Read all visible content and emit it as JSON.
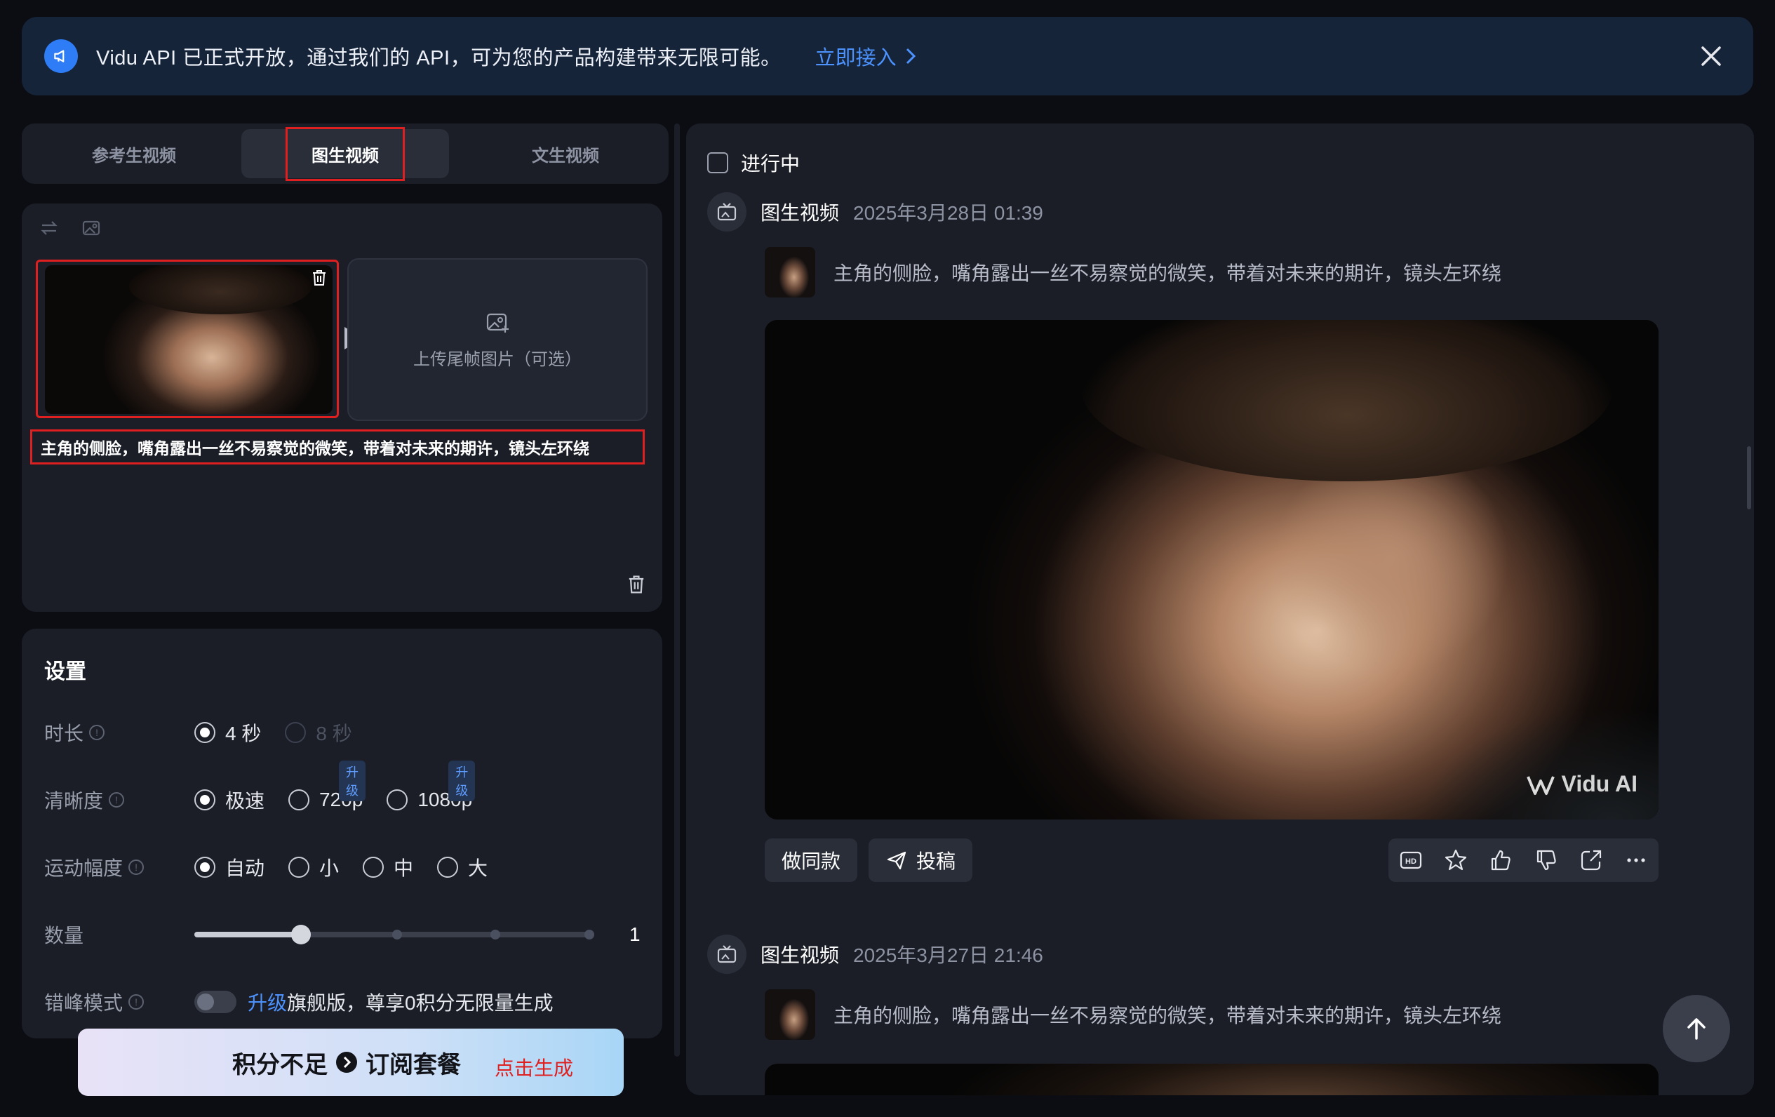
{
  "banner": {
    "text": "Vidu API 已正式开放，通过我们的 API，可为您的产品构建带来无限可能。",
    "link": "立即接入"
  },
  "tabs": [
    "参考生视频",
    "图生视频",
    "文生视频"
  ],
  "input": {
    "upload_end_frame": "上传尾帧图片（可选）",
    "prompt": "主角的侧脸，嘴角露出一丝不易察觉的微笑，带着对未来的期许，镜头左环绕"
  },
  "settings": {
    "title": "设置",
    "duration": {
      "label": "时长",
      "options": [
        "4 秒",
        "8 秒"
      ]
    },
    "resolution": {
      "label": "清晰度",
      "options": [
        "极速",
        "720p",
        "1080p"
      ],
      "upgrade_badge": "升级"
    },
    "motion": {
      "label": "运动幅度",
      "options": [
        "自动",
        "小",
        "中",
        "大"
      ]
    },
    "quantity": {
      "label": "数量",
      "value": "1",
      "level": 0.25
    },
    "offpeak": {
      "label": "错峰模式",
      "link": "升级",
      "text": "旗舰版，尊享0积分无限量生成"
    }
  },
  "cta": {
    "main": "积分不足 ➜ 订阅套餐",
    "main_a": "积分不足",
    "main_b": "订阅套餐",
    "sub": "点击生成"
  },
  "feed": {
    "in_progress": "进行中",
    "items": [
      {
        "type": "图生视频",
        "time": "2025年3月28日 01:39",
        "prompt": "主角的侧脸，嘴角露出一丝不易察觉的微笑，带着对未来的期许，镜头左环绕",
        "watermark": "Vidu AI"
      },
      {
        "type": "图生视频",
        "time": "2025年3月27日 21:46",
        "prompt": "主角的侧脸，嘴角露出一丝不易察觉的微笑，带着对未来的期许，镜头左环绕"
      }
    ],
    "actions": {
      "same": "做同款",
      "submit": "投稿"
    }
  },
  "colors": {
    "accent": "#4c93ff",
    "highlight": "#e02020",
    "panel": "#1b1e27",
    "background": "#0b0d13"
  }
}
